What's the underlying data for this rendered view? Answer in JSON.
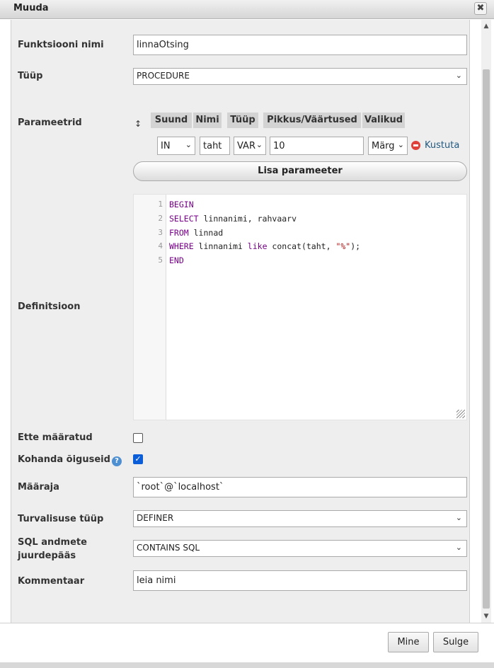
{
  "dialog": {
    "title": "Muuda",
    "close_symbol": "✖"
  },
  "fields": {
    "name_label": "Funktsiooni nimi",
    "name_value": "linnaOtsing",
    "type_label": "Tüüp",
    "type_value": "PROCEDURE",
    "params_label": "Parameetrid",
    "definition_label": "Definitsioon",
    "deterministic_label": "Ette määratud",
    "adjust_privileges_label": "Kohanda õiguseid",
    "definer_label": "Määraja",
    "definer_value": "`root`@`localhost`",
    "security_type_label": "Turvalisuse tüüp",
    "security_type_value": "DEFINER",
    "sql_access_label_line1": "SQL andmete",
    "sql_access_label_line2": "juurdepääs",
    "sql_access_value": "CONTAINS SQL",
    "comment_label": "Kommentaar",
    "comment_value": "leia nimi"
  },
  "checkboxes": {
    "deterministic": false,
    "adjust_privileges": true,
    "checkmark": "✓"
  },
  "params": {
    "headers": [
      "Suund",
      "Nimi",
      "Tüüp",
      "Pikkus/Väärtused",
      "Valikud"
    ],
    "row": {
      "drag_handle": "↕",
      "direction": "IN",
      "name": "taht",
      "type": "VAR",
      "length": "10",
      "options": "Märg",
      "delete_label": "Kustuta"
    },
    "add_button": "Lisa parameeter"
  },
  "editor": {
    "line_numbers": [
      "1",
      "2",
      "3",
      "4",
      "5"
    ],
    "lines": [
      [
        {
          "t": "BEGIN",
          "c": "kw"
        }
      ],
      [
        {
          "t": "SELECT",
          "c": "kw"
        },
        {
          "t": " linnanimi, rahvaarv",
          "c": ""
        }
      ],
      [
        {
          "t": "FROM",
          "c": "kw"
        },
        {
          "t": " linnad",
          "c": ""
        }
      ],
      [
        {
          "t": "WHERE",
          "c": "kw"
        },
        {
          "t": " linnanimi ",
          "c": ""
        },
        {
          "t": "like",
          "c": "kw"
        },
        {
          "t": " concat(taht, ",
          "c": ""
        },
        {
          "t": "\"%\"",
          "c": "str"
        },
        {
          "t": ");",
          "c": ""
        }
      ],
      [
        {
          "t": "END",
          "c": "kw"
        }
      ]
    ]
  },
  "footer": {
    "go_button": "Mine",
    "close_button": "Sulge"
  },
  "colors": {
    "accent": "#0b5ed7",
    "panel": "#eeeeee",
    "keyword": "#770088",
    "string": "#aa1111"
  }
}
